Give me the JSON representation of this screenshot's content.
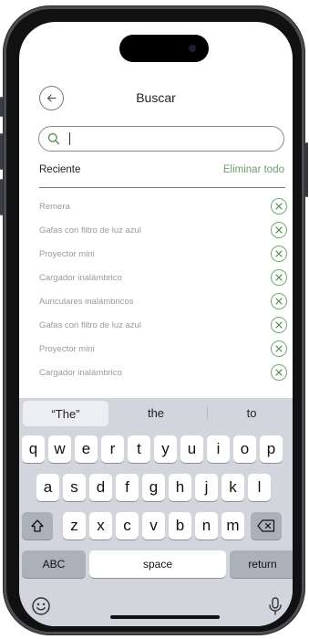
{
  "header": {
    "title": "Buscar",
    "back_icon": "arrow-left-icon"
  },
  "search": {
    "placeholder": "",
    "value": "",
    "icon": "search-icon"
  },
  "recent": {
    "heading": "Reciente",
    "clear_label": "Eliminar todo",
    "items": [
      "Remera",
      "Gafas con filtro de luz azul",
      "Proyector mini",
      "Cargador inalámbrico",
      "Auriculares inalámbricos",
      "Gafas con filtro de luz azul",
      "Proyector mini",
      "Cargador inalámbrico"
    ]
  },
  "keyboard": {
    "suggestions": [
      "“The”",
      "the",
      "to"
    ],
    "row1": [
      "q",
      "w",
      "e",
      "r",
      "t",
      "y",
      "u",
      "i",
      "o",
      "p"
    ],
    "row2": [
      "a",
      "s",
      "d",
      "f",
      "g",
      "h",
      "j",
      "k",
      "l"
    ],
    "row3": [
      "z",
      "x",
      "c",
      "v",
      "b",
      "n",
      "m"
    ],
    "abc_label": "ABC",
    "space_label": "space",
    "return_label": "return"
  },
  "colors": {
    "accent": "#6d9c6d",
    "keyboard_bg": "#d2d5db"
  }
}
